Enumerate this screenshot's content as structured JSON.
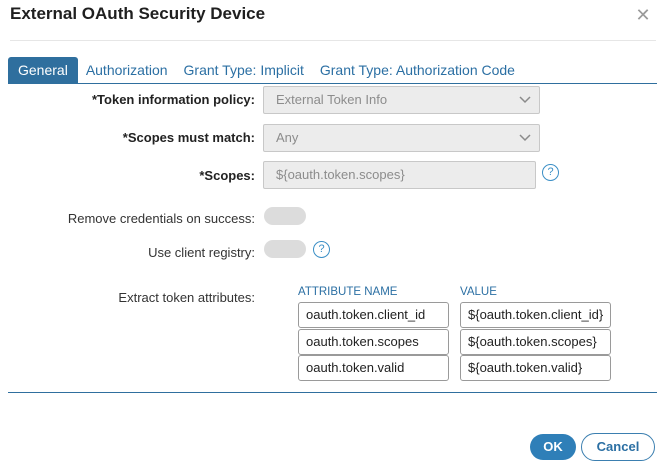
{
  "dialog": {
    "title": "External OAuth Security Device"
  },
  "tabs": [
    {
      "label": "General",
      "active": true
    },
    {
      "label": "Authorization",
      "active": false
    },
    {
      "label": "Grant Type: Implicit",
      "active": false
    },
    {
      "label": "Grant Type: Authorization Code",
      "active": false
    }
  ],
  "form": {
    "token_policy": {
      "label": "*Token information policy:",
      "value": "External Token Info"
    },
    "scopes_match": {
      "label": "*Scopes must match:",
      "value": "Any"
    },
    "scopes": {
      "label": "*Scopes:",
      "value": "${oauth.token.scopes}"
    },
    "remove_credentials": {
      "label": "Remove credentials on success:",
      "enabled": false
    },
    "client_registry": {
      "label": "Use client registry:",
      "enabled": false
    },
    "extract": {
      "label": "Extract token attributes:",
      "col_name": "ATTRIBUTE NAME",
      "col_value": "VALUE",
      "rows": [
        {
          "name": "oauth.token.client_id",
          "value": "${oauth.token.client_id}"
        },
        {
          "name": "oauth.token.scopes",
          "value": "${oauth.token.scopes}"
        },
        {
          "name": "oauth.token.valid",
          "value": "${oauth.token.valid}"
        }
      ]
    }
  },
  "buttons": {
    "ok": "OK",
    "cancel": "Cancel"
  },
  "icons": {
    "close": "close-icon",
    "chevron": "chevron-down-icon",
    "help": "help-icon"
  },
  "colors": {
    "accent": "#2f6f9e",
    "link": "#2b6fa3",
    "help": "#3b8fc6"
  }
}
